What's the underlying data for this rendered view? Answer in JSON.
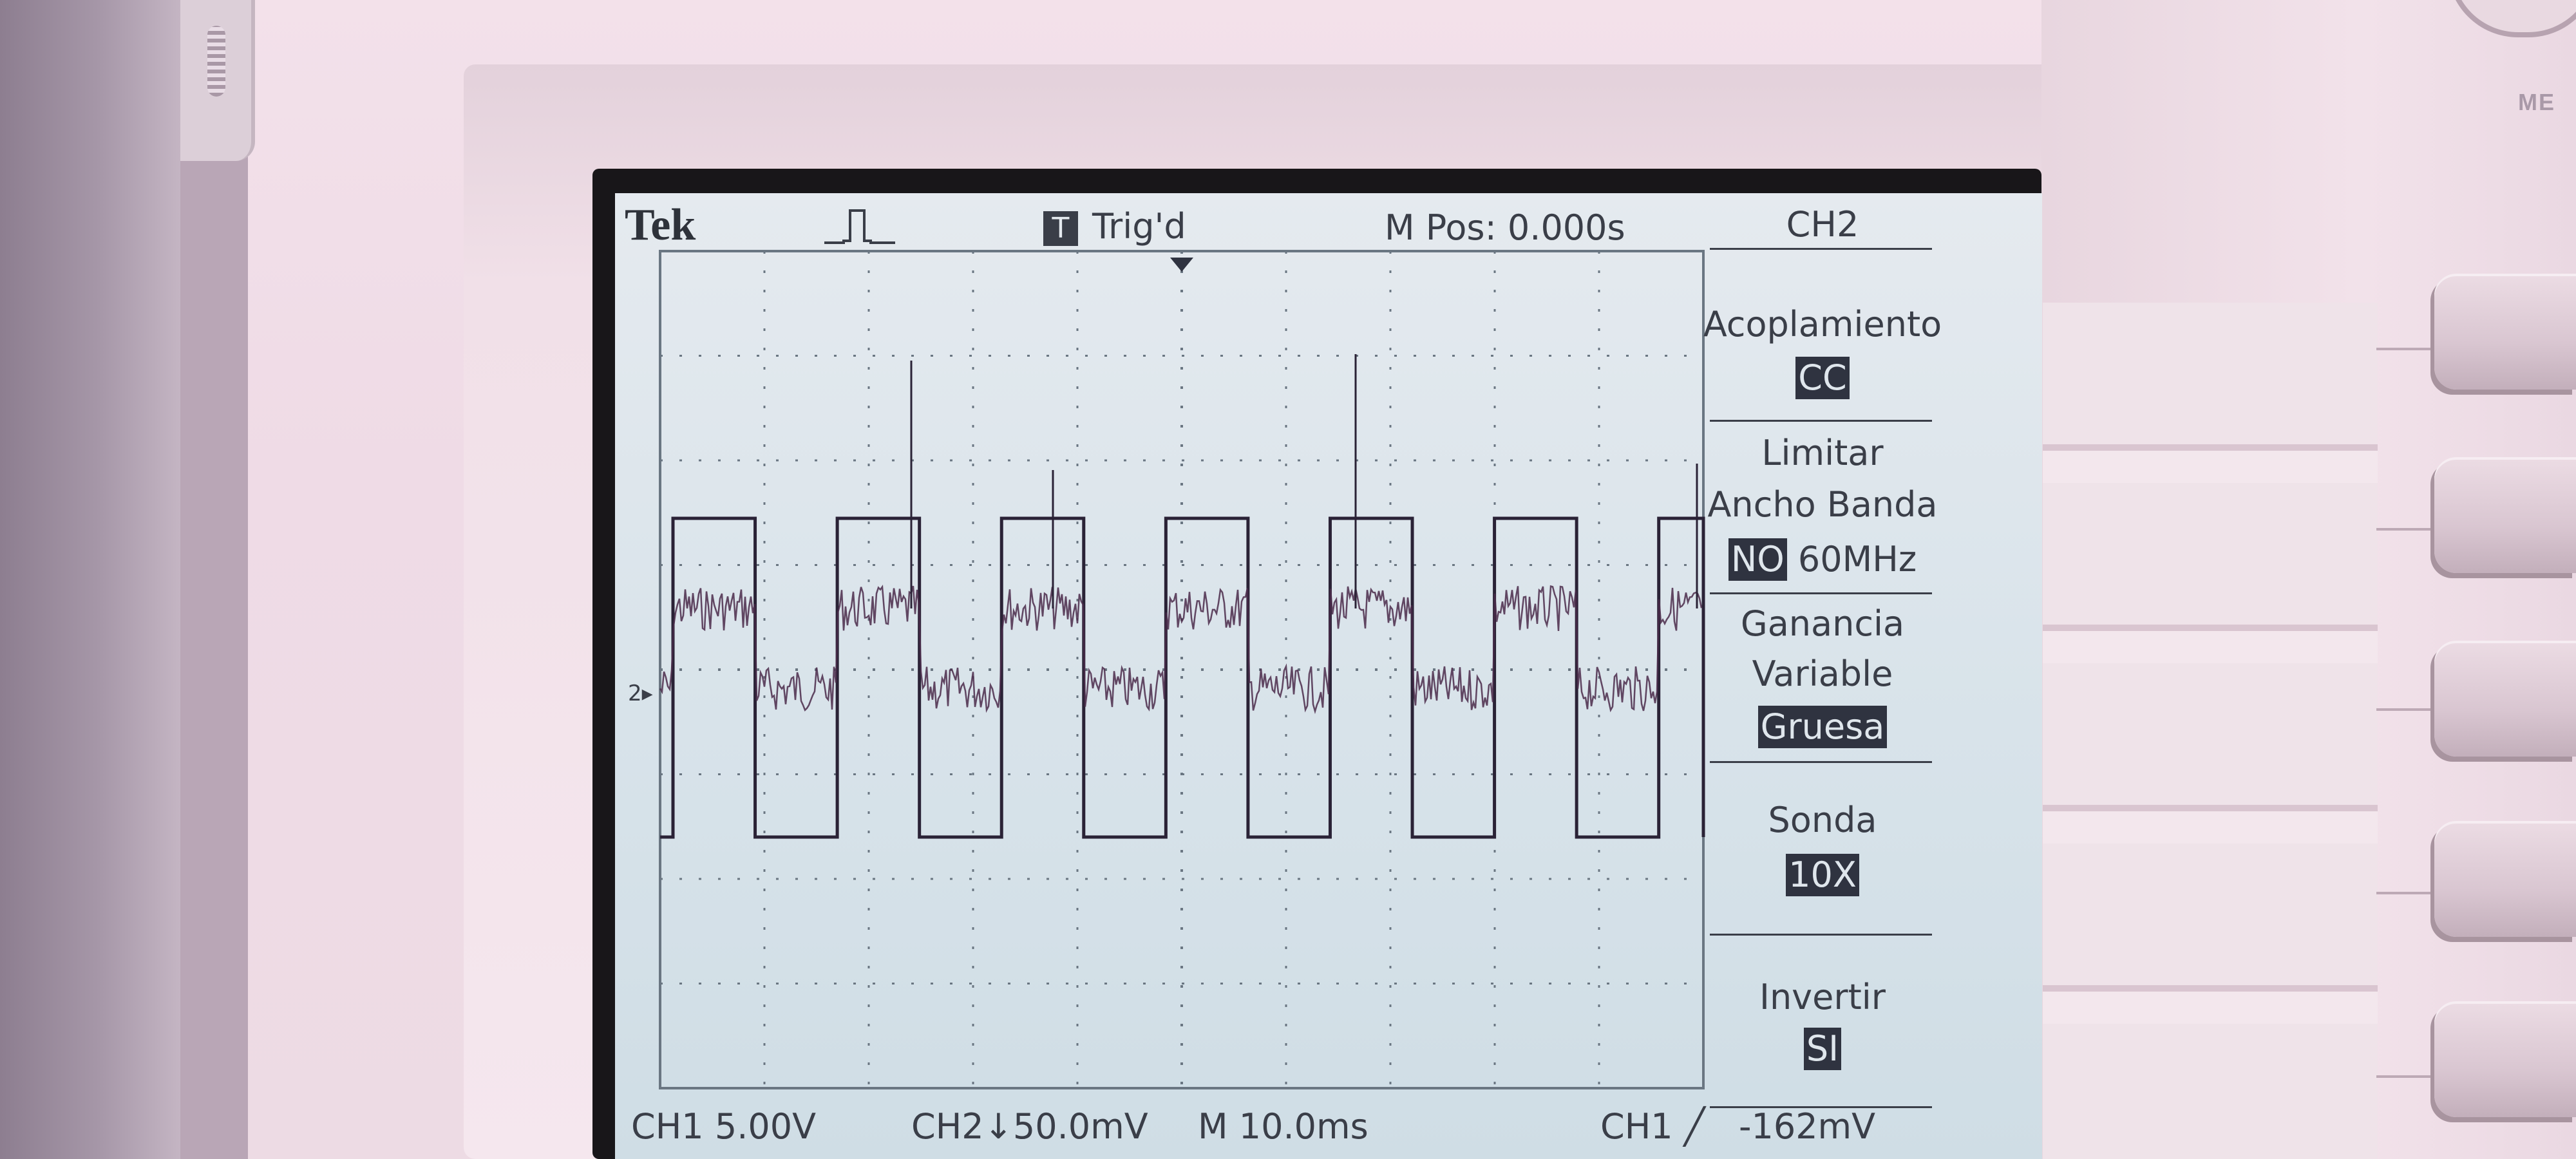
{
  "header": {
    "brand": "Tek",
    "trigger_indicator": "T",
    "trigger_status": "Trig'd",
    "main_position": "M Pos: 0.000s",
    "channel_menu_title": "CH2"
  },
  "side_menu": {
    "coupling_label": "Acoplamiento",
    "coupling_value": "CC",
    "bandwidth_label_line1": "Limitar",
    "bandwidth_label_line2": "Ancho Banda",
    "bandwidth_value": "NO",
    "bandwidth_freq": "60MHz",
    "gain_label_line1": "Ganancia",
    "gain_label_line2": "Variable",
    "gain_value": "Gruesa",
    "probe_label": "Sonda",
    "probe_value": "10X",
    "invert_label": "Invertir",
    "invert_value": "SI"
  },
  "footer": {
    "ch1_scale": "CH1  5.00V",
    "ch2_scale": "CH2↓50.0mV",
    "timebase": "M 10.0ms",
    "trigger_source": "CH1",
    "trigger_level": "-162mV"
  },
  "brand_panel": {
    "menu_button_label": "ME"
  },
  "channel_marker": "2",
  "colors": {
    "lcd_background": "#dbe4eb",
    "trace": "#2a2236",
    "trace_tint": "#4a2a4a",
    "grid": "#6a7682",
    "highlight_box": "#2f3340"
  }
}
